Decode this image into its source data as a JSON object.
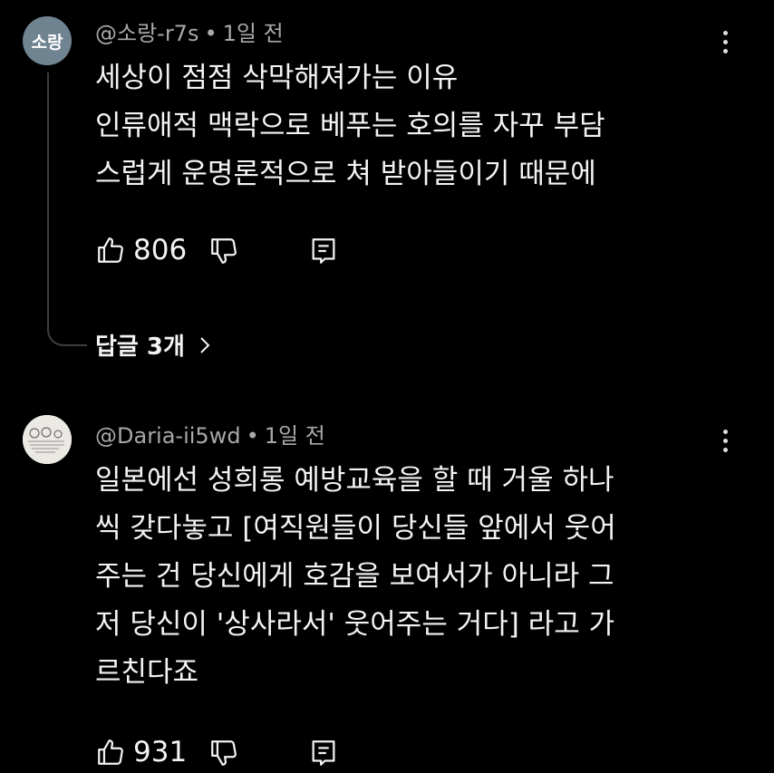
{
  "comments": [
    {
      "avatar_text": "소랑",
      "author": "@소랑-r7s",
      "time": "1일 전",
      "lines": [
        "세상이 점점 삭막해져가는 이유",
        "인류애적 맥락으로 베푸는 호의를 자꾸 부담",
        "스럽게 운명론적으로 쳐 받아들이기 때문에"
      ],
      "likes": "806",
      "replies_label": "답글 3개"
    },
    {
      "author": "@Daria-ii5wd",
      "time": "1일 전",
      "lines": [
        "일본에선 성희롱 예방교육을 할 때 거울 하나",
        "씩 갖다놓고 [여직원들이 당신들 앞에서 웃어",
        "주는 건 당신에게 호감을 보여서가 아니라 그",
        "저 당신이 '상사라서' 웃어주는 거다] 라고 가",
        "르친다죠"
      ],
      "likes": "931"
    }
  ],
  "meta_separator": "•",
  "icons": {
    "like": "thumbs-up-icon",
    "dislike": "thumbs-down-icon",
    "reply": "reply-icon",
    "more": "more-vert-icon",
    "chevron": "chevron-right-icon"
  },
  "colors": {
    "background": "#000000",
    "text": "#f3f3f3",
    "meta": "#a8a8a8",
    "avatar1": "#6f8391"
  }
}
